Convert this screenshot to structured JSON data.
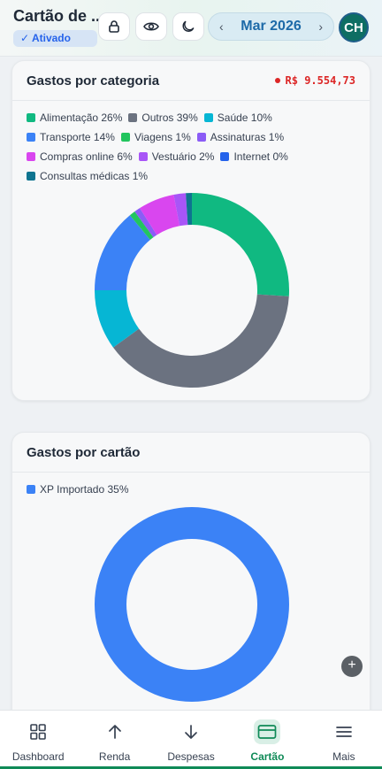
{
  "header": {
    "title": "Cartão de ...",
    "status_badge": "✓ Ativado",
    "month": "Mar 2026",
    "prev_symbol": "‹",
    "next_symbol": "›",
    "avatar_initials": "CH",
    "icons": [
      "lock-icon",
      "eye-icon",
      "moon-icon"
    ]
  },
  "category_card": {
    "title": "Gastos por categoria",
    "total": "R$ 9.554,73",
    "legend_rows": [
      [
        {
          "label": "Alimentação 26%",
          "color": "#10b981"
        },
        {
          "label": "Outros 39%",
          "color": "#6b7280"
        },
        {
          "label": "Saúde 10%",
          "color": "#06b6d4"
        }
      ],
      [
        {
          "label": "Transporte 14%",
          "color": "#3b82f6"
        },
        {
          "label": "Viagens 1%",
          "color": "#22c55e"
        },
        {
          "label": "Assinaturas 1%",
          "color": "#8b5cf6"
        }
      ],
      [
        {
          "label": "Compras online 6%",
          "color": "#d946ef"
        },
        {
          "label": "Vestuário 2%",
          "color": "#a855f7"
        },
        {
          "label": "Internet 0%",
          "color": "#2563eb"
        }
      ],
      [
        {
          "label": "Consultas médicas 1%",
          "color": "#0e7490"
        }
      ]
    ]
  },
  "card_card": {
    "title": "Gastos por cartão",
    "legend_rows": [
      [
        {
          "label": "XP Importado 35%",
          "color": "#3b82f6"
        }
      ]
    ]
  },
  "fab_symbol": "+",
  "nav": {
    "items": [
      {
        "label": "Dashboard",
        "icon": "grid-icon",
        "active": false
      },
      {
        "label": "Renda",
        "icon": "arrow-up-icon",
        "active": false
      },
      {
        "label": "Despesas",
        "icon": "arrow-down-icon",
        "active": false
      },
      {
        "label": "Cartão",
        "icon": "card-icon",
        "active": true
      },
      {
        "label": "Mais",
        "icon": "menu-icon",
        "active": false
      }
    ]
  },
  "chart_data": [
    {
      "type": "pie",
      "title": "Gastos por categoria",
      "categories": [
        "Alimentação",
        "Outros",
        "Saúde",
        "Transporte",
        "Viagens",
        "Assinaturas",
        "Compras online",
        "Vestuário",
        "Internet",
        "Consultas médicas"
      ],
      "values": [
        26,
        39,
        10,
        14,
        1,
        1,
        6,
        2,
        0,
        1
      ],
      "colors": [
        "#10b981",
        "#6b7280",
        "#06b6d4",
        "#3b82f6",
        "#22c55e",
        "#8b5cf6",
        "#d946ef",
        "#a855f7",
        "#2563eb",
        "#0e7490"
      ],
      "donut": true
    },
    {
      "type": "pie",
      "title": "Gastos por cartão",
      "categories": [
        "XP Importado"
      ],
      "values": [
        35
      ],
      "colors": [
        "#3b82f6"
      ],
      "donut": true
    }
  ]
}
